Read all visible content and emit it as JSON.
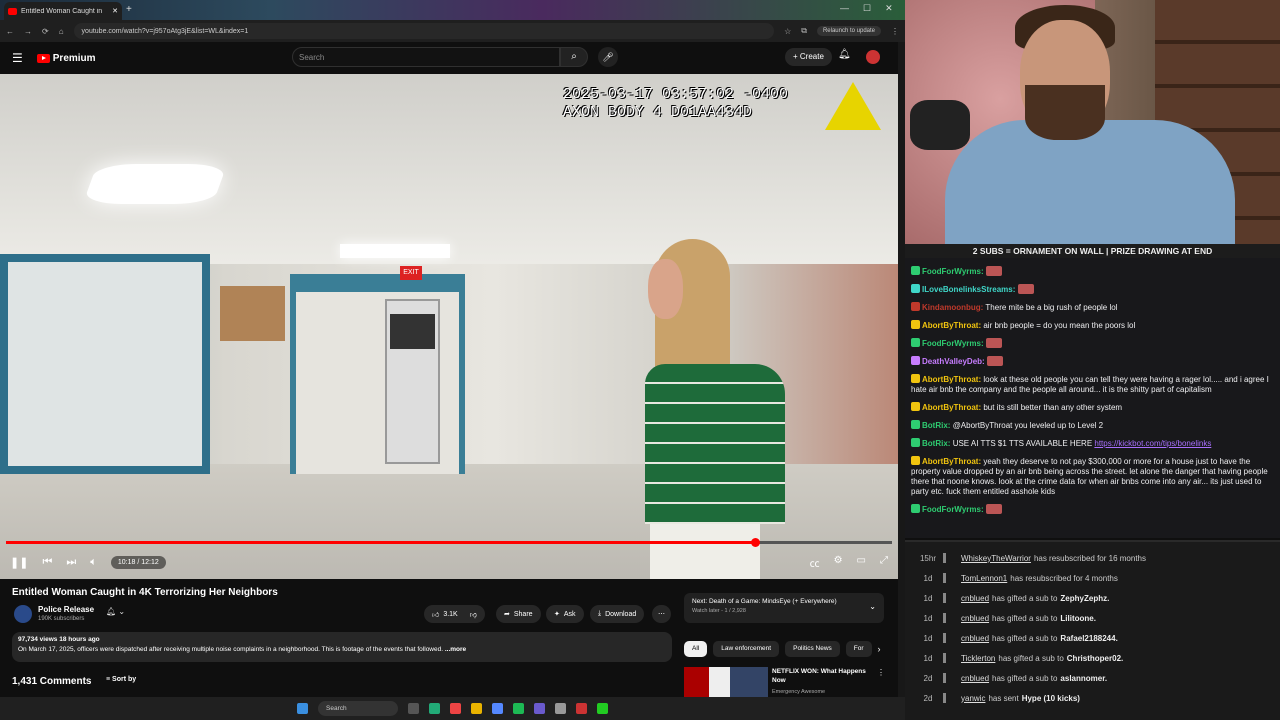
{
  "browser": {
    "tab_title": "Entitled Woman Caught in",
    "url": "youtube.com/watch?v=j957oAtg3jE&list=WL&index=1",
    "relaunch": "Relaunch to update"
  },
  "youtube": {
    "brand": "Premium",
    "search_placeholder": "Search",
    "create_label": "Create"
  },
  "video": {
    "timestamp_line1": "2025-03-17  03:57:02 -0400",
    "timestamp_line2": "AXON BODY 4 D01AA434D",
    "exit_sign": "EXIT",
    "time": "10:18 / 12:12",
    "progress": 0.845
  },
  "meta": {
    "title": "Entitled Woman Caught in 4K Terrorizing Her Neighbors",
    "channel": "Police Release",
    "subscribers": "190K subscribers",
    "likes": "3.1K",
    "share": "Share",
    "ask": "Ask",
    "download": "Download",
    "views_line": "97,734 views  18 hours ago",
    "description": "On March 17, 2025, officers were dispatched after receiving multiple noise complaints in a neighborhood. This is footage of the events that followed.",
    "more": "...more",
    "comments": "1,431 Comments",
    "sort": "Sort by"
  },
  "sidebar": {
    "next_title": "Next: Death of a Game: MindsEye (+ Everywhere)",
    "next_sub": "Watch later - 1 / 2,928",
    "chips": [
      "All",
      "Law enforcement",
      "Politics News",
      "For"
    ],
    "rec_title": "NETFLIX WON: What Happens Now",
    "rec_channel": "Emergency Awesome"
  },
  "taskbar": {
    "search": "Search"
  },
  "stream": {
    "banner": "2 SUBS = ORNAMENT ON WALL | PRIZE DRAWING AT END",
    "chat": [
      {
        "user": "FoodForWyrms:",
        "color": "#2ecc71",
        "text": ""
      },
      {
        "user": "ILoveBonelinksStreams:",
        "color": "#3fd6c8",
        "text": ""
      },
      {
        "user": "Kindamoonbug:",
        "color": "#c0392b",
        "text": "There mite be a big rush of people lol"
      },
      {
        "user": "AbortByThroat:",
        "color": "#f1c40f",
        "text": "air bnb people = do you mean the poors lol"
      },
      {
        "user": "FoodForWyrms:",
        "color": "#2ecc71",
        "text": ""
      },
      {
        "user": "DeathValleyDeb:",
        "color": "#c77dff",
        "text": ""
      },
      {
        "user": "AbortByThroat:",
        "color": "#f1c40f",
        "text": "look at these old people you can tell they were having a rager lol..... and i agree I hate air bnb the company and the people all around... it is the shitty part of capitalism"
      },
      {
        "user": "AbortByThroat:",
        "color": "#f1c40f",
        "text": "but its still better than any other system"
      },
      {
        "user": "BotRix:",
        "color": "#2ecc71",
        "text": "@AbortByThroat you leveled up to Level 2"
      },
      {
        "user": "BotRix:",
        "color": "#2ecc71",
        "text": "USE AI TTS $1 TTS AVAILABLE HERE ",
        "link": "https://kickbot.com/tips/bonelinks"
      },
      {
        "user": "AbortByThroat:",
        "color": "#f1c40f",
        "text": "yeah they deserve to not pay $300,000 or more for a house just to have the property value dropped by an air bnb being across the street. let alone the danger that having people there that noone knows. look at the crime data for when air bnbs come into any air... its just used to party etc. fuck them entitled asshole kids"
      },
      {
        "user": "FoodForWyrms:",
        "color": "#2ecc71",
        "text": ""
      }
    ],
    "events": [
      {
        "age": "15hr",
        "name": "WhiskeyTheWarrior",
        "text": "has resubscribed for 16 months",
        "target": ""
      },
      {
        "age": "1d",
        "name": "TomLennon1",
        "text": "has resubscribed for 4 months",
        "target": ""
      },
      {
        "age": "1d",
        "name": "cnblued",
        "text": "has gifted a sub to",
        "target": "ZephyZephz."
      },
      {
        "age": "1d",
        "name": "cnblued",
        "text": "has gifted a sub to",
        "target": "Lilitoone."
      },
      {
        "age": "1d",
        "name": "cnblued",
        "text": "has gifted a sub to",
        "target": "Rafael2188244."
      },
      {
        "age": "1d",
        "name": "Ticklerton",
        "text": "has gifted a sub to",
        "target": "Christhoper02."
      },
      {
        "age": "2d",
        "name": "cnblued",
        "text": "has gifted a sub to",
        "target": "aslannomer."
      },
      {
        "age": "2d",
        "name": "yanwic",
        "text": "has sent",
        "target": "Hype (10 kicks)"
      }
    ]
  }
}
